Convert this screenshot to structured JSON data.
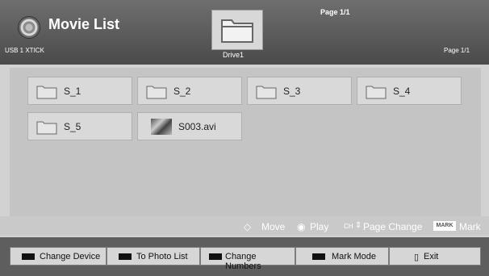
{
  "header": {
    "title": "Movie List",
    "device": "USB 1 XTICK",
    "drive": "Drive1",
    "page_top": "Page 1/1",
    "page_right": "Page 1/1"
  },
  "items": [
    {
      "name": "S_1"
    },
    {
      "name": "S_2"
    },
    {
      "name": "S_3"
    },
    {
      "name": "S_4"
    },
    {
      "name": "S_5"
    },
    {
      "name": "S003.avi"
    }
  ],
  "help": {
    "move": "Move",
    "play": "Play",
    "page_change_prefix": "CH",
    "page_change": "Page Change",
    "mark_key": "MARK",
    "mark": "Mark"
  },
  "buttons": [
    {
      "label": "Change Device"
    },
    {
      "label": "To Photo List"
    },
    {
      "label": "Change Numbers"
    },
    {
      "label": "Mark Mode"
    },
    {
      "label": "Exit"
    }
  ]
}
